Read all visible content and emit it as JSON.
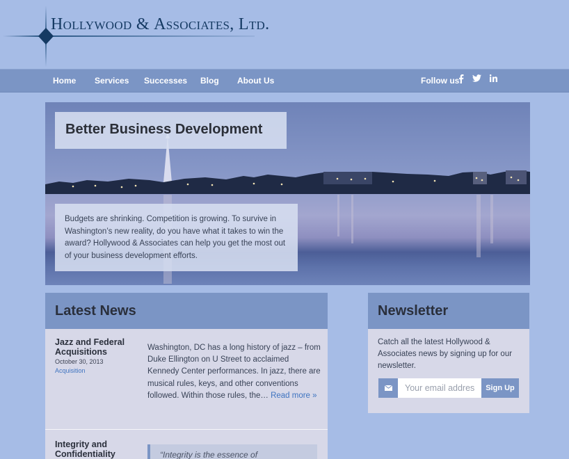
{
  "logo": {
    "text_h": "H",
    "text_1": "ollywood & ",
    "text_a": "A",
    "text_2": "ssociates, ",
    "text_l": "L",
    "text_3": "td."
  },
  "nav": {
    "items": [
      "Home",
      "Services",
      "Successes",
      "Blog",
      "About Us"
    ],
    "follow_label": "Follow us:",
    "social": [
      "facebook-icon",
      "twitter-icon",
      "linkedin-icon"
    ]
  },
  "hero": {
    "title": "Better Business Development",
    "text": "Budgets are shrinking. Competition is growing. To survive in Washington’s new reality, do you have what it takes to win the award? Hollywood & Associates can help you get the most out of your business development efforts."
  },
  "news": {
    "heading": "Latest News",
    "items": [
      {
        "title": "Jazz and Federal Acquisitions",
        "date": "October 30, 2013",
        "category": "Acquisition",
        "body": "Washington, DC has a long history of jazz – from Duke Ellington on U Street to acclaimed Kennedy Center performances. In jazz, there are musical rules, keys, and other conventions followed. Within those rules, the…",
        "more": "Read more »"
      },
      {
        "title": "Integrity and Confidentiality",
        "quote": "“Integrity is the essence of"
      }
    ]
  },
  "newsletter": {
    "heading": "Newsletter",
    "text": "Catch all the latest Hollywood & Associates news by signing up for our newsletter.",
    "placeholder": "Your email address",
    "button": "Sign Up"
  },
  "colors": {
    "background": "#a6bce6",
    "nav": "#7b95c5",
    "panel": "#d7d8e8",
    "link": "#3f74c0",
    "logo": "#153a63"
  }
}
